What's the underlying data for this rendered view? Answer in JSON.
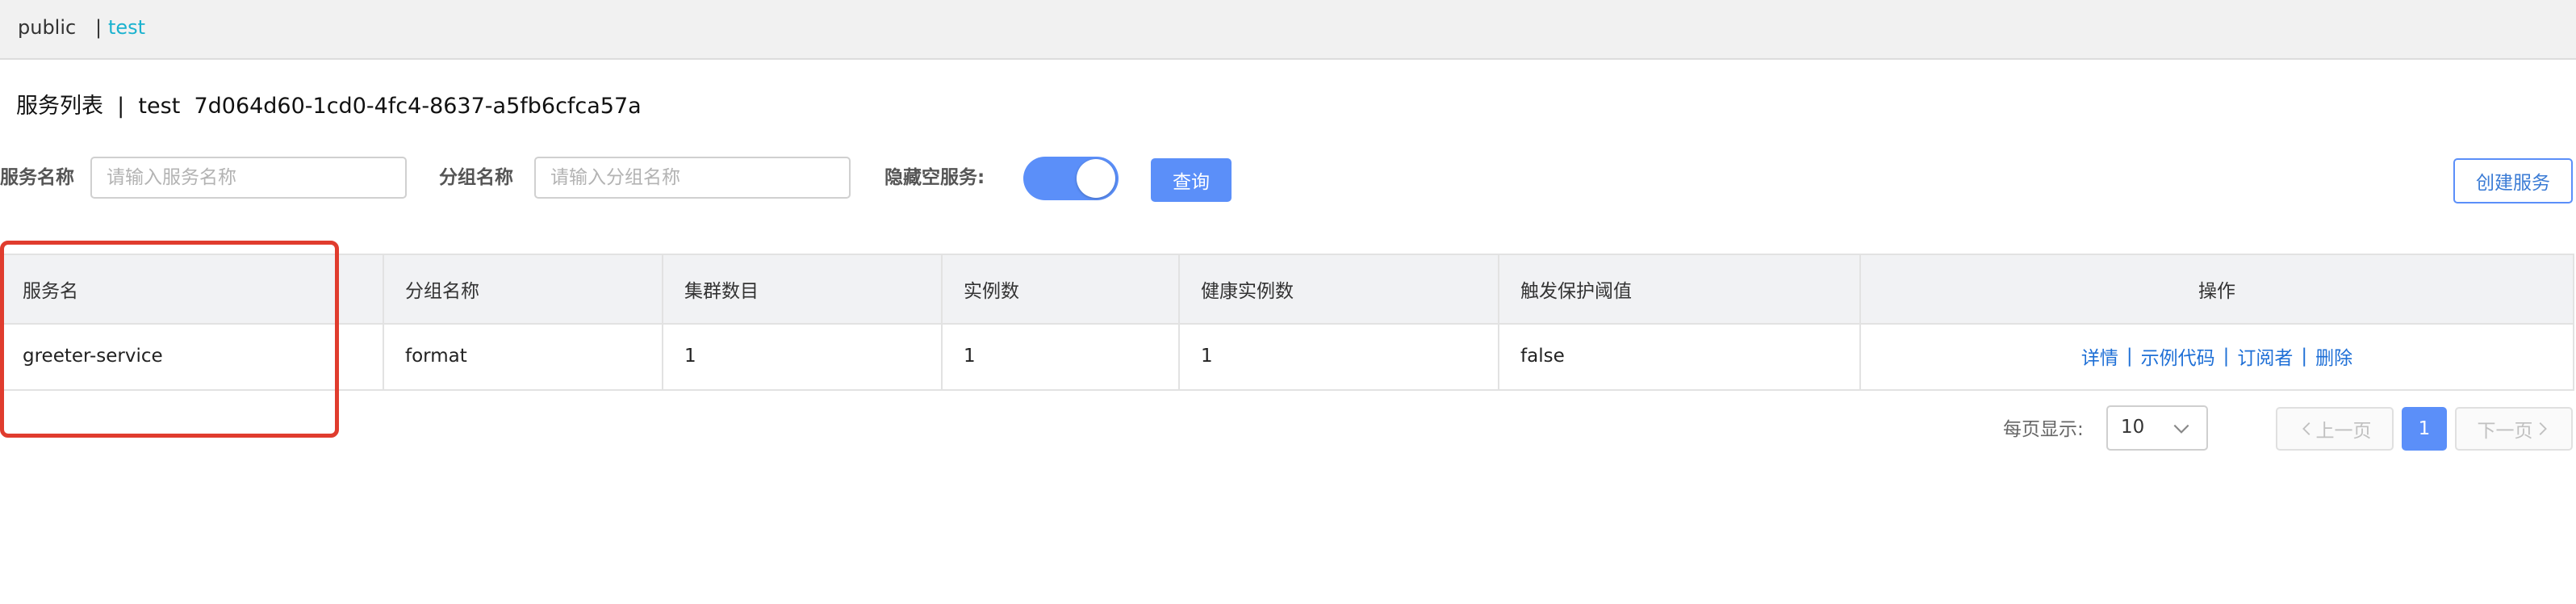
{
  "namespaces": {
    "public": "public",
    "separator": "|",
    "test": "test"
  },
  "page_title": "服务列表  |  test  7d064d60-1cd0-4fc4-8637-a5fb6cfca57a",
  "filters": {
    "service_name_label": "服务名称",
    "service_name_placeholder": "请输入服务名称",
    "service_name_value": "",
    "group_name_label": "分组名称",
    "group_name_placeholder": "请输入分组名称",
    "group_name_value": "",
    "hide_empty_label": "隐藏空服务:",
    "hide_empty_on": true,
    "query_button": "查询",
    "create_button": "创建服务"
  },
  "table": {
    "headers": [
      "服务名",
      "分组名称",
      "集群数目",
      "实例数",
      "健康实例数",
      "触发保护阈值",
      "操作"
    ],
    "rows": [
      [
        "greeter-service",
        "format",
        "1",
        "1",
        "1",
        "false"
      ]
    ],
    "actions": {
      "detail": "详情",
      "sample_code": "示例代码",
      "subscribers": "订阅者",
      "delete": "删除",
      "separator": "|"
    }
  },
  "pagination": {
    "page_size_label": "每页显示:",
    "page_size": "10",
    "prev": "上一页",
    "current_page": "1",
    "next": "下一页"
  },
  "colors": {
    "primary": "#5b8ff9",
    "link": "#1e6fd6",
    "active_namespace": "#1ab2cf",
    "highlight": "#e03c2e"
  }
}
